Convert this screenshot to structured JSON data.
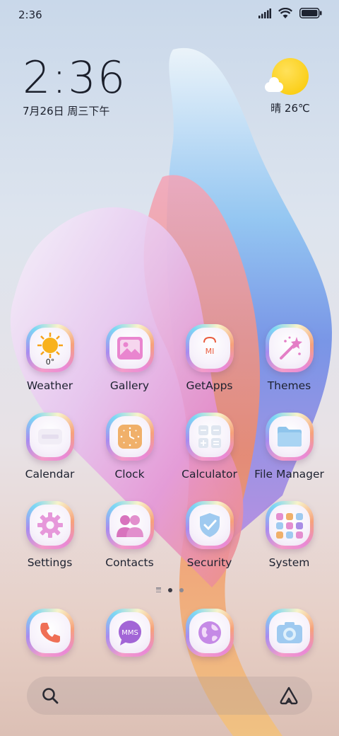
{
  "status_bar": {
    "time": "2:36",
    "icons": [
      "signal-icon",
      "wifi-icon",
      "battery-icon"
    ]
  },
  "clock_widget": {
    "time": "2:36",
    "date": "7月26日 周三下午"
  },
  "weather_widget": {
    "text": "晴 26℃"
  },
  "apps": [
    {
      "label": "Weather",
      "icon": "weather-icon",
      "badge_text": "0°"
    },
    {
      "label": "Gallery",
      "icon": "gallery-icon"
    },
    {
      "label": "GetApps",
      "icon": "getapps-icon",
      "badge_text": "MI"
    },
    {
      "label": "Themes",
      "icon": "themes-icon"
    },
    {
      "label": "Calendar",
      "icon": "calendar-icon"
    },
    {
      "label": "Clock",
      "icon": "clock-icon"
    },
    {
      "label": "Calculator",
      "icon": "calculator-icon"
    },
    {
      "label": "File Manager",
      "icon": "folder-icon"
    },
    {
      "label": "Settings",
      "icon": "gear-icon"
    },
    {
      "label": "Contacts",
      "icon": "contacts-icon"
    },
    {
      "label": "Security",
      "icon": "shield-icon"
    },
    {
      "label": "System",
      "icon": "system-folder-icon"
    }
  ],
  "page_indicator": {
    "pages": 2,
    "active": 1
  },
  "dock": [
    {
      "name": "phone",
      "icon": "phone-icon"
    },
    {
      "name": "messages",
      "icon": "messages-icon",
      "badge_text": "MMS"
    },
    {
      "name": "browser",
      "icon": "globe-icon"
    },
    {
      "name": "camera",
      "icon": "camera-icon"
    }
  ],
  "search_bar": {
    "icons": [
      "search-icon",
      "assistant-icon"
    ]
  },
  "colors": {
    "accent_pink": "#e98fd2",
    "peach": "#f0b88e",
    "sky": "#8ec6f0"
  }
}
